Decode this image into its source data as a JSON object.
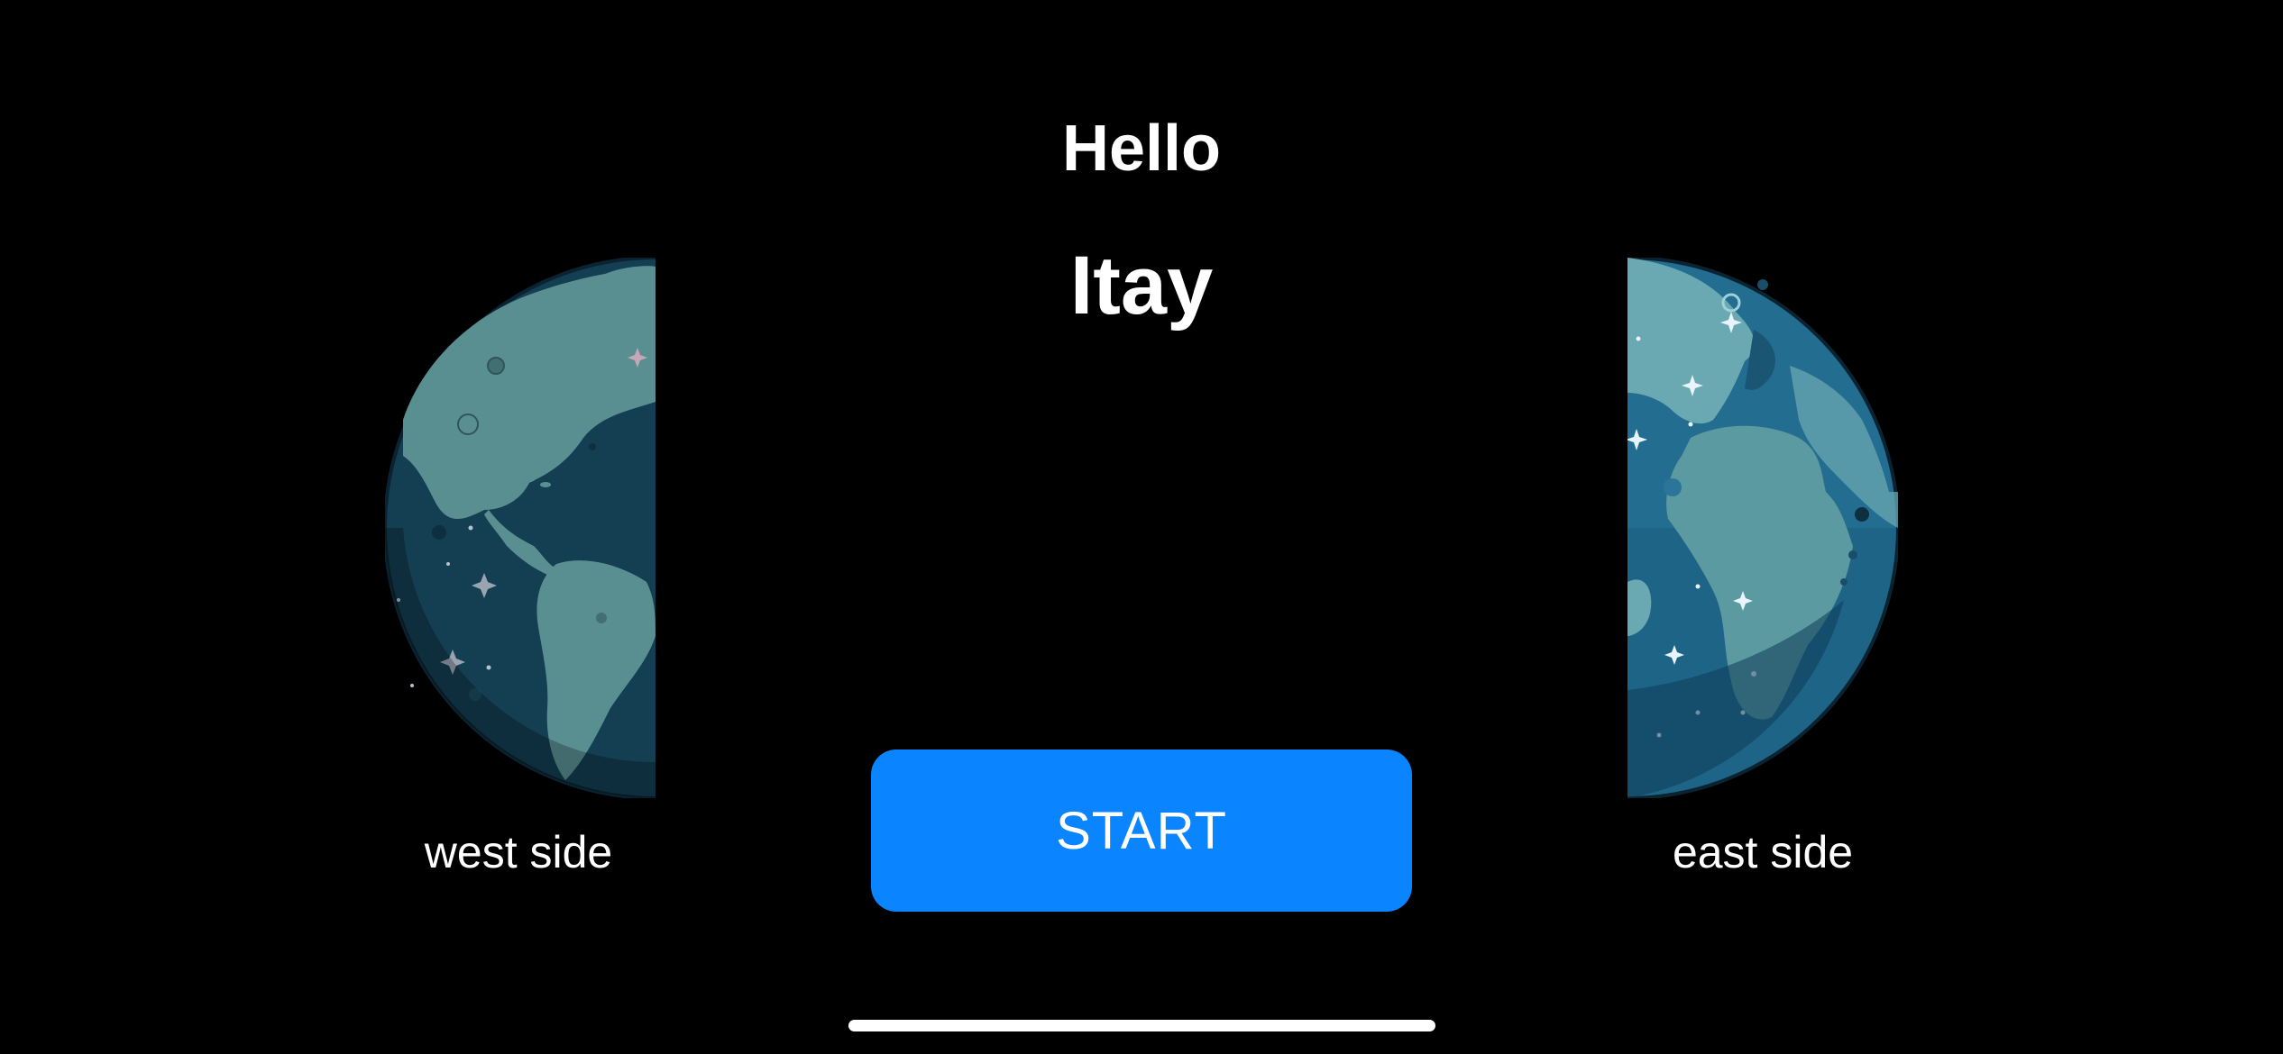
{
  "greeting": {
    "hello": "Hello",
    "name": "Itay"
  },
  "globes": {
    "west": {
      "label": "west side",
      "icon": "globe-west-hemisphere-icon"
    },
    "east": {
      "label": "east side",
      "icon": "globe-east-hemisphere-icon"
    }
  },
  "start_button": {
    "label": "START",
    "color": "#0b84ff"
  },
  "colors": {
    "background": "#000000",
    "ocean_dark": "#133d52",
    "ocean_light": "#1f6a8a",
    "land": "#5e9595"
  }
}
